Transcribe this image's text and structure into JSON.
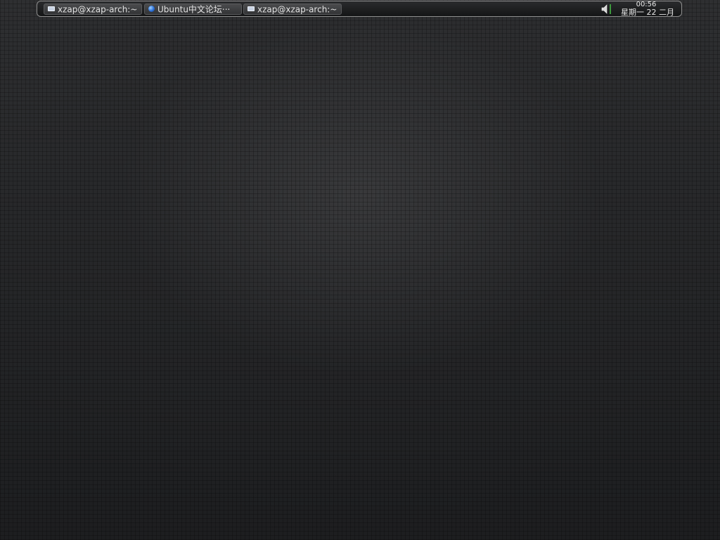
{
  "taskbar": {
    "tasks": [
      {
        "label": "xzap@xzap-arch:~",
        "icon": "terminal-icon"
      },
      {
        "label": "Ubuntu中文论坛···",
        "icon": "browser-icon"
      },
      {
        "label": "xzap@xzap-arch:~",
        "icon": "terminal-icon"
      }
    ]
  },
  "tray": {
    "volume_icon": "speaker-icon",
    "meter_color": "#3c9a3c"
  },
  "clock": {
    "time": "00:56",
    "date": "星期一 22 二月"
  }
}
